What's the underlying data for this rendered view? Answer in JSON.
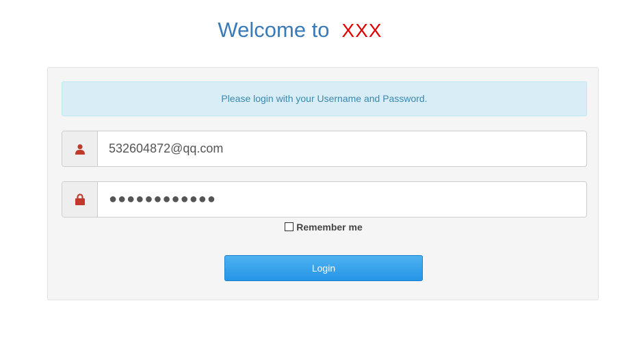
{
  "header": {
    "welcome": "Welcome to",
    "brand": "XXX"
  },
  "login": {
    "message": "Please login with your Username and Password.",
    "username_value": "532604872@qq.com",
    "password_mask": "●●●●●●●●●●●●",
    "remember_label": "Remember me",
    "remember_checked": false,
    "submit_label": "Login"
  },
  "icons": {
    "username": "user-icon",
    "password": "lock-icon"
  },
  "colors": {
    "title": "#3a7ab7",
    "brand": "#e00000",
    "icon": "#c0392b",
    "button": "#2595e8",
    "alert_bg": "#d9edf7"
  }
}
